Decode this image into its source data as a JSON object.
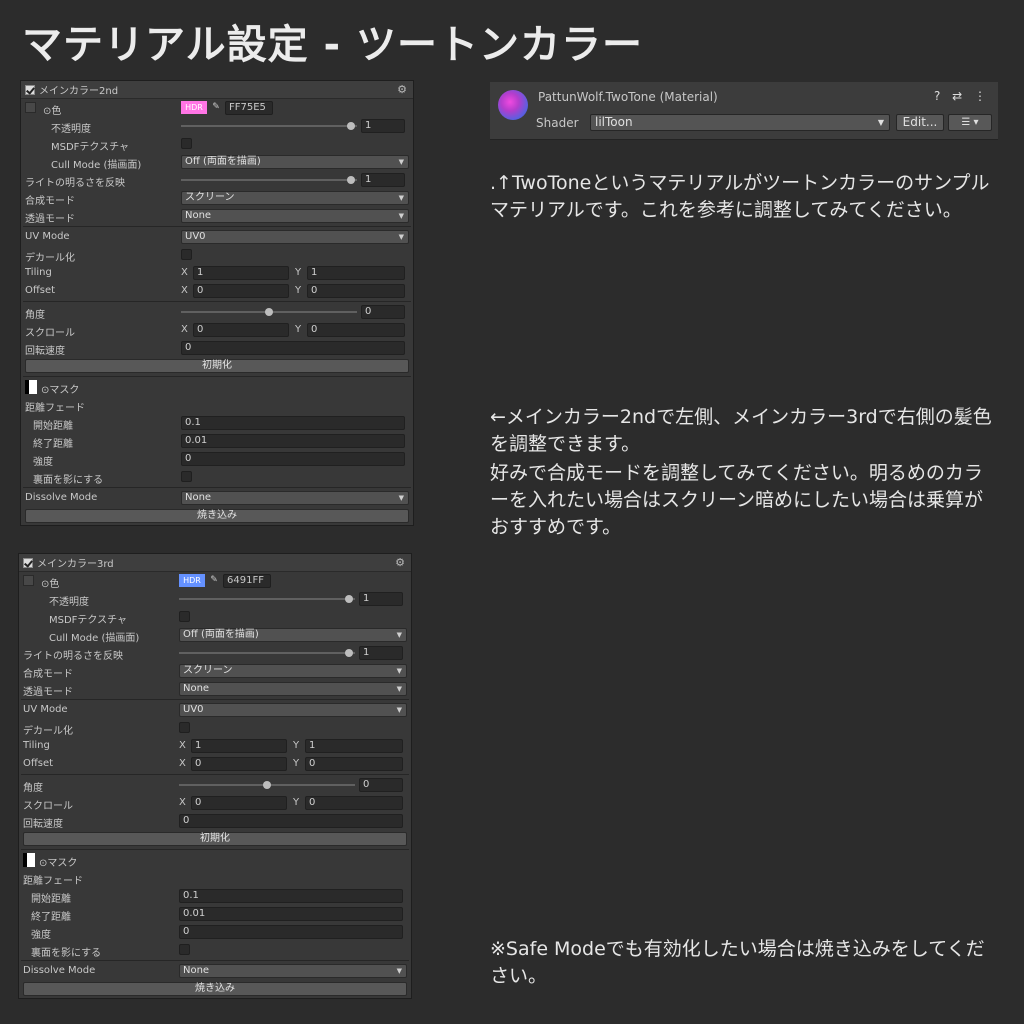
{
  "page_title": "マテリアル設定 - ツートンカラー",
  "panels": [
    {
      "header": "メインカラー2nd",
      "color_label": "⊙色",
      "hdr": "HDR",
      "hdr_color": "#ff75e5",
      "hex": "FF75E5",
      "opacity_label": "不透明度",
      "opacity_value": "1",
      "msdf_label": "MSDFテクスチャ",
      "cull_label": "Cull Mode (描画面)",
      "cull_value": "Off (両面を描画)",
      "light_label": "ライトの明るさを反映",
      "light_value": "1",
      "blend_label": "合成モード",
      "blend_value": "スクリーン",
      "alpha_label": "透過モード",
      "alpha_value": "None",
      "uv_label": "UV Mode",
      "uv_value": "UV0",
      "decal_label": "デカール化",
      "tiling_label": "Tiling",
      "tiling_x": "1",
      "tiling_y": "1",
      "offset_label": "Offset",
      "offset_x": "0",
      "offset_y": "0",
      "angle_label": "角度",
      "angle_value": "0",
      "scroll_label": "スクロール",
      "scroll_x": "0",
      "scroll_y": "0",
      "rot_label": "回転速度",
      "rot_value": "0",
      "init_button": "初期化",
      "mask_label": "⊙マスク",
      "fade_label": "距離フェード",
      "fade_start_label": "開始距離",
      "fade_start": "0.1",
      "fade_end_label": "終了距離",
      "fade_end": "0.01",
      "strength_label": "強度",
      "strength": "0",
      "backface_label": "裏面を影にする",
      "dissolve_label": "Dissolve Mode",
      "dissolve_value": "None",
      "bake_button": "焼き込み",
      "axis_x": "X",
      "axis_y": "Y"
    },
    {
      "header": "メインカラー3rd",
      "color_label": "⊙色",
      "hdr": "HDR",
      "hdr_color": "#6491ff",
      "hex": "6491FF",
      "opacity_label": "不透明度",
      "opacity_value": "1",
      "msdf_label": "MSDFテクスチャ",
      "cull_label": "Cull Mode (描画面)",
      "cull_value": "Off (両面を描画)",
      "light_label": "ライトの明るさを反映",
      "light_value": "1",
      "blend_label": "合成モード",
      "blend_value": "スクリーン",
      "alpha_label": "透過モード",
      "alpha_value": "None",
      "uv_label": "UV Mode",
      "uv_value": "UV0",
      "decal_label": "デカール化",
      "tiling_label": "Tiling",
      "tiling_x": "1",
      "tiling_y": "1",
      "offset_label": "Offset",
      "offset_x": "0",
      "offset_y": "0",
      "angle_label": "角度",
      "angle_value": "0",
      "scroll_label": "スクロール",
      "scroll_x": "0",
      "scroll_y": "0",
      "rot_label": "回転速度",
      "rot_value": "0",
      "init_button": "初期化",
      "mask_label": "⊙マスク",
      "fade_label": "距離フェード",
      "fade_start_label": "開始距離",
      "fade_start": "0.1",
      "fade_end_label": "終了距離",
      "fade_end": "0.01",
      "strength_label": "強度",
      "strength": "0",
      "backface_label": "裏面を影にする",
      "dissolve_label": "Dissolve Mode",
      "dissolve_value": "None",
      "bake_button": "焼き込み",
      "axis_x": "X",
      "axis_y": "Y"
    }
  ],
  "inspector": {
    "material_name": "PattunWolf.TwoTone (Material)",
    "icons": "? ⇄ ⋮",
    "shader_label": "Shader",
    "shader_value": "lilToon",
    "edit_button": "Edit...",
    "menu_button": "☰ ▾"
  },
  "notes": {
    "note1": ".↑TwoToneというマテリアルがツートンカラーのサンプルマテリアルです。これを参考に調整してみてください。",
    "note2": "←メインカラー2ndで左側、メインカラー3rdで右側の髪色を調整できます。",
    "note3": "好みで合成モードを調整してみてください。明るめのカラーを入れたい場合はスクリーン暗めにしたい場合は乗算がおすすめです。",
    "note4": "※Safe Modeでも有効化したい場合は焼き込みをしてください。"
  }
}
